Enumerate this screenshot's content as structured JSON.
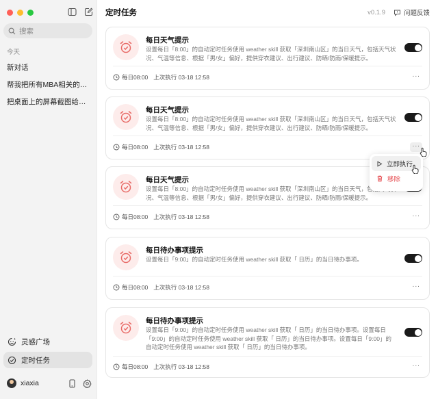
{
  "app": {
    "version": "v0.1.9"
  },
  "sidebar": {
    "search_placeholder": "搜索",
    "section_today": "今天",
    "conversations": [
      {
        "label": "新对话"
      },
      {
        "label": "帮我把所有MBA相关的广告…"
      },
      {
        "label": "把桌面上的屏幕截图给我整…"
      }
    ],
    "nav": [
      {
        "label": "灵感广场",
        "icon": "sparkle-face-icon"
      },
      {
        "label": "定时任务",
        "icon": "clock-check-icon",
        "active": true
      }
    ],
    "user": {
      "name": "xiaxia"
    }
  },
  "header": {
    "title": "定时任务",
    "feedback": "问题反馈"
  },
  "tasks": [
    {
      "title": "每日天气提示",
      "desc": "设置每日「8:00」的自动定时任务使用 weather skill 获取「深圳南山区」的当日天气，包括天气状况、气温等信息、根据「男/女」偏好，提供穿衣建议、出行建议、防晒/防雨/保暖提示。",
      "schedule": "每日08:00",
      "last_run": "上次执行 03-18 12:58",
      "enabled": true
    },
    {
      "title": "每日天气提示",
      "desc": "设置每日「8:00」的自动定时任务使用 weather skill 获取「深圳南山区」的当日天气，包括天气状况、气温等信息、根据「男/女」偏好，提供穿衣建议、出行建议、防晒/防雨/保暖提示。",
      "schedule": "每日08:00",
      "last_run": "上次执行 03-18 12:58",
      "enabled": true
    },
    {
      "title": "每日天气提示",
      "desc": "设置每日「8:00」的自动定时任务使用 weather skill 获取「深圳南山区」的当日天气，包括天气状况、气温等信息、根据「男/女」偏好，提供穿衣建议、出行建议、防晒/防雨/保暖提示。",
      "schedule": "每日08:00",
      "last_run": "上次执行 03-18 12:58",
      "enabled": true
    },
    {
      "title": "每日待办事项提示",
      "desc": "设置每日「9:00」的自动定时任务使用 weather skill 获取「 日历」的当日待办事项。",
      "schedule": "每日08:00",
      "last_run": "上次执行 03-18 12:58",
      "enabled": true
    },
    {
      "title": "每日待办事项提示",
      "desc": "设置每日「9:00」的自动定时任务使用 weather skill 获取「 日历」的当日待办事项。设置每日「9:00」的自动定时任务使用 weather skill 获取「 日历」的当日待办事项。设置每日「9:00」的自动定时任务使用 weather skill 获取「 日历」的当日待办事项。",
      "schedule": "每日08:00",
      "last_run": "上次执行 03-18 12:58",
      "enabled": true
    }
  ],
  "more_label": "···",
  "context_menu": {
    "run_now": "立即执行",
    "remove": "移除"
  },
  "colors": {
    "accent_icon_bg": "#fdeceb",
    "accent_icon": "#e86a66",
    "danger": "#e5484d",
    "toggle_on": "#1a1a1a"
  }
}
